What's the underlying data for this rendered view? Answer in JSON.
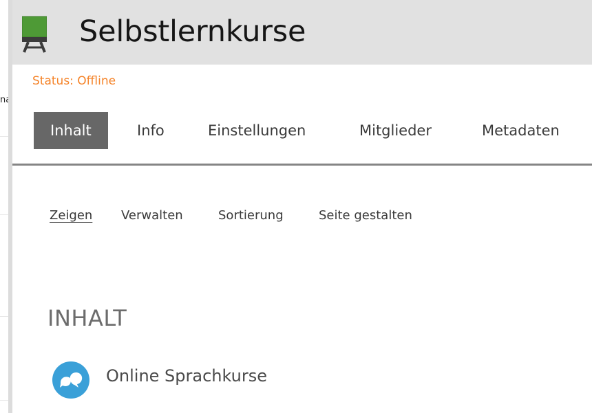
{
  "background_page": {
    "cut_text": "na"
  },
  "header": {
    "title": "Selbstlernkurse",
    "icon": "learning-module-icon"
  },
  "status": {
    "text": "Status: Offline",
    "color": "#f5842a"
  },
  "tabs": [
    {
      "label": "Inhalt",
      "active": true
    },
    {
      "label": "Info",
      "active": false
    },
    {
      "label": "Einstellungen",
      "active": false
    },
    {
      "label": "Mitglieder",
      "active": false
    },
    {
      "label": "Metadaten",
      "active": false
    }
  ],
  "subtabs": [
    {
      "label": "Zeigen",
      "active": true
    },
    {
      "label": "Verwalten",
      "active": false
    },
    {
      "label": "Sortierung",
      "active": false
    },
    {
      "label": "Seite gestalten",
      "active": false
    }
  ],
  "content": {
    "section_title": "INHALT",
    "items": [
      {
        "label": "Online Sprachkurse",
        "icon": "speech-bubbles-icon",
        "icon_color": "#3aa0d8"
      }
    ]
  }
}
